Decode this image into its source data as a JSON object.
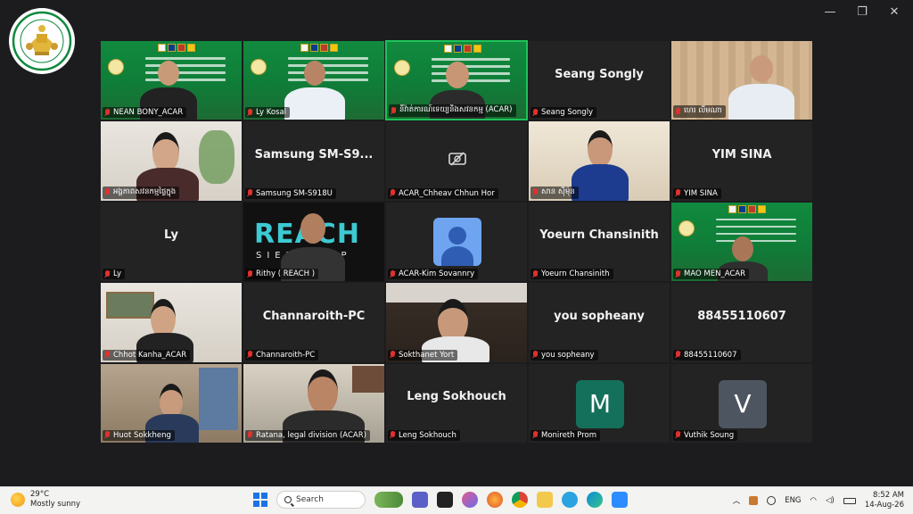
{
  "window": {
    "minimize": "—",
    "restore": "❐",
    "close": "✕"
  },
  "participants": [
    {
      "label": "NEAN BONY_ACAR",
      "kind": "banner"
    },
    {
      "label": "Ly Kosal",
      "kind": "banner"
    },
    {
      "label": "នីវ៉ាត់ការណ៍ទេយ្យនិងសវនកម្ម (ACAR)",
      "kind": "banner",
      "active": true
    },
    {
      "label": "Seang Songly",
      "display": "Seang Songly",
      "kind": "name"
    },
    {
      "label": "ហេរ លីមណា",
      "kind": "video"
    },
    {
      "label": "អង្គភាពសវនកម្មផ្ទៃក្នុង",
      "kind": "video"
    },
    {
      "label": "Samsung SM-S918U",
      "display": "Samsung  SM-S9...",
      "kind": "name"
    },
    {
      "label": "ACAR_Chheav Chhun Hor",
      "kind": "camoff"
    },
    {
      "label": "សាន ស៊ីម៉ុន",
      "kind": "video"
    },
    {
      "label": "YIM SINA",
      "display": "YIM SINA",
      "kind": "name"
    },
    {
      "label": "Ly",
      "display": "Ly",
      "kind": "name"
    },
    {
      "label": "Rithy ( REACH )",
      "kind": "reach",
      "brand": "REACH",
      "brand_sub": "SIEM REAP"
    },
    {
      "label": "ACAR-Kim Sovannry",
      "kind": "default-avatar"
    },
    {
      "label": "Yoeurn Chansinith",
      "display": "Yoeurn Chansinith",
      "kind": "name"
    },
    {
      "label": "MAO MEN_ACAR",
      "kind": "banner"
    },
    {
      "label": "Chhot Kanha_ACAR",
      "kind": "video"
    },
    {
      "label": "Channaroith-PC",
      "display": "Channaroith-PC",
      "kind": "name"
    },
    {
      "label": "Sokthanet Yort",
      "kind": "video"
    },
    {
      "label": "you sopheany",
      "display": "you sopheany",
      "kind": "name"
    },
    {
      "label": "88455110607",
      "display": "88455110607",
      "kind": "name"
    },
    {
      "label": "Huot Sokkheng",
      "kind": "video"
    },
    {
      "label": "Ratana, legal division (ACAR)",
      "kind": "video"
    },
    {
      "label": "Leng Sokhouch",
      "display": "Leng Sokhouch",
      "kind": "name"
    },
    {
      "label": "Monireth Prom",
      "kind": "letter",
      "letter": "M",
      "color": "#14705a"
    },
    {
      "label": "Vuthik Soung",
      "kind": "letter",
      "letter": "V",
      "color": "#4d5560"
    }
  ],
  "taskbar": {
    "temperature": "29°C",
    "weather": "Mostly sunny",
    "search_label": "Search",
    "language": "ENG",
    "time": "8:52 AM",
    "date": "14-Aug-26"
  },
  "colors": {
    "active_border": "#1ec25a",
    "muted_mic": "#e0312e",
    "banner_green": "#118a3e"
  }
}
